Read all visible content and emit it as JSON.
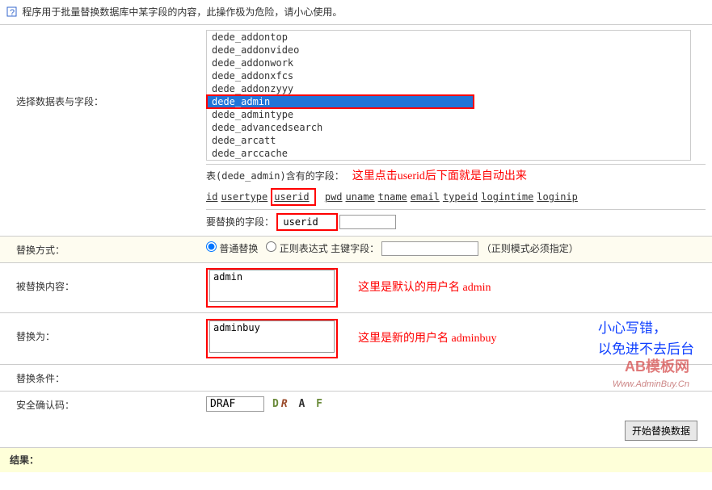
{
  "warn": "程序用于批量替换数据库中某字段的内容，此操作极为危险，请小心使用。",
  "lab": {
    "sel": "选择数据表与字段：",
    "mode": "替换方式：",
    "from": "被替换内容：",
    "to": "替换为：",
    "cond": "替换条件：",
    "cap": "安全确认码：",
    "res": "结果："
  },
  "tables": [
    "dede_addontop",
    "dede_addonvideo",
    "dede_addonwork",
    "dede_addonxfcs",
    "dede_addonzyyy",
    "dede_admin",
    "dede_admintype",
    "dede_advancedsearch",
    "dede_arcatt",
    "dede_arccache"
  ],
  "selected": "dede_admin",
  "fieldsLabel": "表(dede_admin)含有的字段：",
  "fields": [
    "id",
    "usertype",
    "userid",
    "pwd",
    "uname",
    "tname",
    "email",
    "typeid",
    "logintime",
    "loginip"
  ],
  "repLabel": "要替换的字段：",
  "repVal": "userid",
  "an": {
    "fields": "这里点击userid后下面就是自动出来",
    "from": "这里是默认的用户名 admin",
    "to": "这里是新的用户名 adminbuy",
    "b1": "小心写错，",
    "b2": "以免进不去后台"
  },
  "mode": {
    "normal": "普通替换",
    "regex": "正则表达式",
    "pk": "主键字段：",
    "note": "（正则模式必须指定）"
  },
  "from": "admin",
  "to": "adminbuy",
  "capVal": "DRAF",
  "btn": "开始替换数据",
  "logo": {
    "t": "AB模板网",
    "u": "Www.AdminBuy.Cn"
  }
}
